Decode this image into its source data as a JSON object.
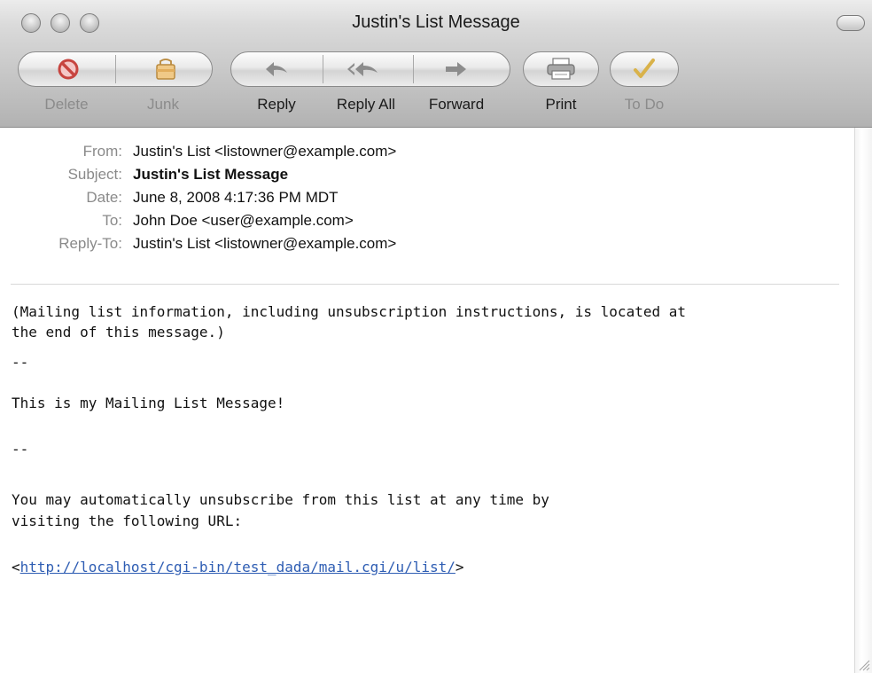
{
  "window": {
    "title": "Justin's List Message"
  },
  "toolbar": {
    "delete_label": "Delete",
    "junk_label": "Junk",
    "reply_label": "Reply",
    "reply_all_label": "Reply All",
    "forward_label": "Forward",
    "print_label": "Print",
    "todo_label": "To Do"
  },
  "headers": {
    "from_label": "From:",
    "from_value": "Justin's List <listowner@example.com>",
    "subject_label": "Subject:",
    "subject_value": "Justin's List Message",
    "date_label": "Date:",
    "date_value": "June 8, 2008 4:17:36 PM MDT",
    "to_label": "To:",
    "to_value": "John Doe <user@example.com>",
    "replyto_label": "Reply-To:",
    "replyto_value": "Justin's List <listowner@example.com>"
  },
  "body": {
    "line1": "(Mailing list information, including unsubscription instructions, is located at",
    "line2": "the end of this message.)",
    "dash1": "--",
    "message": "This is my Mailing List Message!",
    "dash2": "--",
    "unsub1": "You may automatically unsubscribe from this list at any time by",
    "unsub2": "visiting the following URL:",
    "url_open": "<",
    "url": "http://localhost/cgi-bin/test_dada/mail.cgi/u/list/",
    "url_close": ">"
  },
  "colors": {
    "link": "#2e5db3",
    "header_label": "#8a8a8a"
  }
}
